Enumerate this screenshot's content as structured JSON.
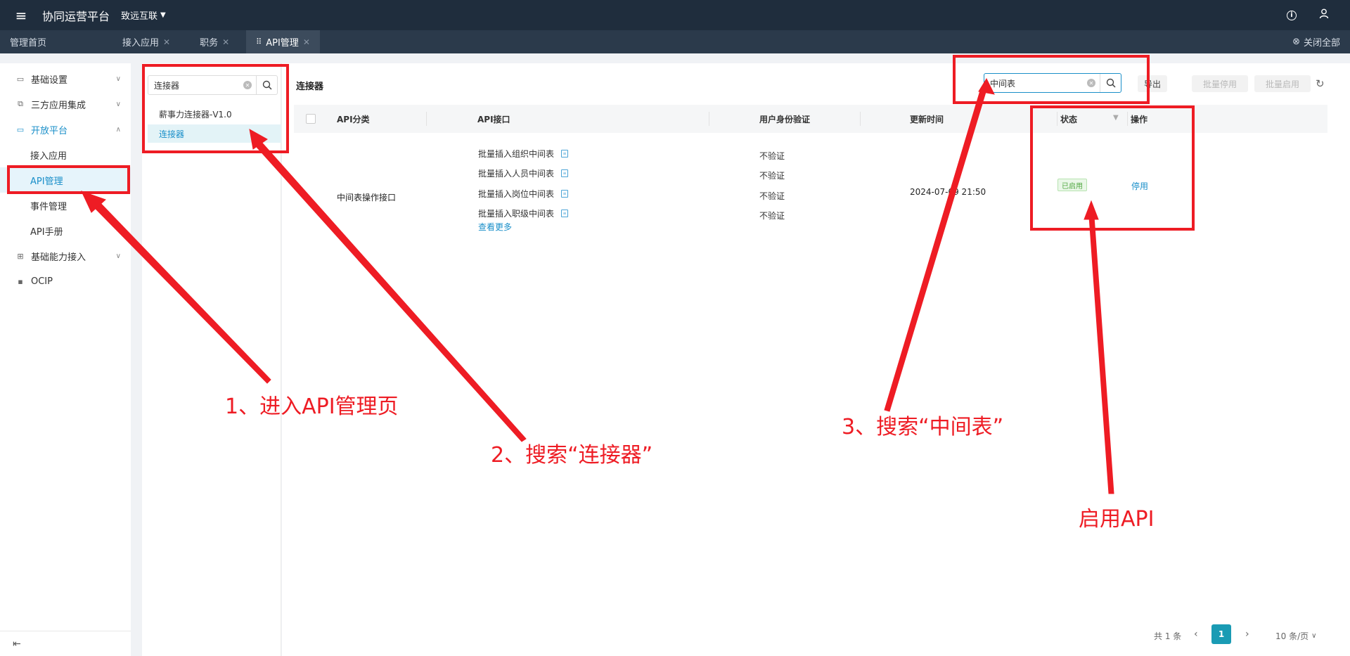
{
  "topbar": {
    "app_title": "协同运营平台",
    "org_name": "致远互联"
  },
  "tabs": [
    {
      "label": "管理首页"
    },
    {
      "label": "接入应用"
    },
    {
      "label": "职务"
    },
    {
      "label": "API管理"
    }
  ],
  "close_all": "关闭全部",
  "sidebar": {
    "items": [
      {
        "label": "基础设置"
      },
      {
        "label": "三方应用集成"
      },
      {
        "label": "开放平台"
      },
      {
        "label": "基础能力接入"
      },
      {
        "label": "OCIP"
      }
    ],
    "sub_items": [
      {
        "label": "接入应用"
      },
      {
        "label": "API管理"
      },
      {
        "label": "事件管理"
      },
      {
        "label": "API手册"
      }
    ]
  },
  "category": {
    "search_value": "连接器",
    "items": [
      {
        "label": "薪事力连接器-V1.0"
      },
      {
        "label": "连接器"
      }
    ]
  },
  "main": {
    "title": "连接器",
    "search_value": "中间表",
    "export_label": "导出",
    "batch_disable_label": "批量停用",
    "batch_enable_label": "批量启用"
  },
  "table": {
    "headers": {
      "category": "API分类",
      "api": "API接口",
      "auth": "用户身份验证",
      "updated": "更新时间",
      "status": "状态",
      "ops": "操作"
    },
    "row": {
      "category": "中间表操作接口",
      "apis": [
        "批量插入组织中间表",
        "批量插入人员中间表",
        "批量插入岗位中间表",
        "批量插入职级中间表"
      ],
      "auths": [
        "不验证",
        "不验证",
        "不验证",
        "不验证"
      ],
      "more": "查看更多",
      "updated": "2024-07-09 21:50",
      "status": "已启用",
      "op": "停用"
    }
  },
  "pager": {
    "total": "共 1 条",
    "current": "1",
    "page_size": "10 条/页"
  },
  "annotations": {
    "step1": "1、进入API管理页",
    "step2": "2、搜索“连接器”",
    "step3": "3、搜索“中间表”",
    "step4": "启用API"
  }
}
